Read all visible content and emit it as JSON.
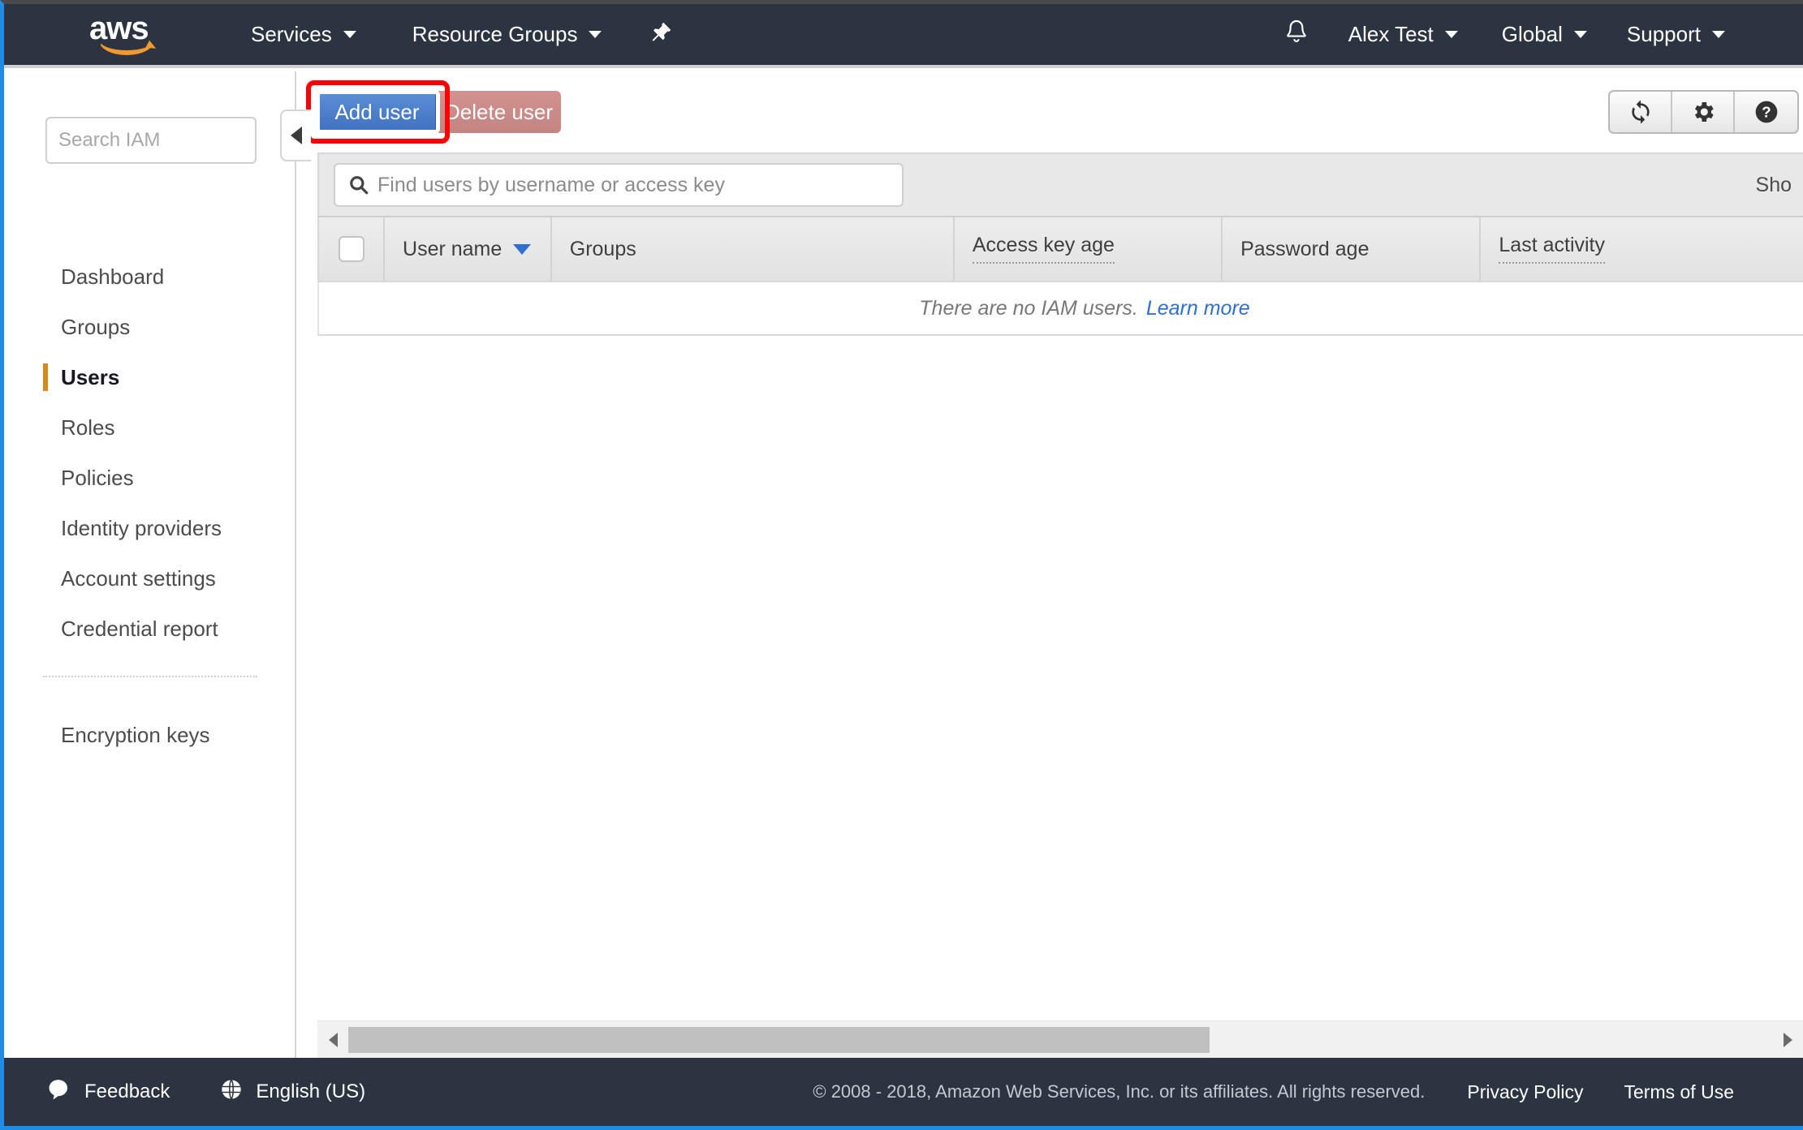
{
  "topnav": {
    "logo_text": "aws",
    "logo_name": "aws-logo",
    "services_label": "Services",
    "resource_groups_label": "Resource Groups",
    "pin_icon": "pin-icon",
    "bell_icon": "bell-notification-icon",
    "account_label": "Alex Test",
    "region_label": "Global",
    "support_label": "Support"
  },
  "sidebar": {
    "search_placeholder": "Search IAM",
    "search_value": "",
    "items": [
      {
        "label": "Dashboard",
        "active": false
      },
      {
        "label": "Groups",
        "active": false
      },
      {
        "label": "Users",
        "active": true
      },
      {
        "label": "Roles",
        "active": false
      },
      {
        "label": "Policies",
        "active": false
      },
      {
        "label": "Identity providers",
        "active": false
      },
      {
        "label": "Account settings",
        "active": false
      },
      {
        "label": "Credential report",
        "active": false
      }
    ],
    "secondary_items": [
      {
        "label": "Encryption keys",
        "active": false
      }
    ],
    "collapse_icon": "chevron-left-icon"
  },
  "actionbar": {
    "add_user_label": "Add user",
    "delete_user_label": "Delete user",
    "highlight_color": "#fb0007",
    "add_user_color": "#3f71c0",
    "delete_user_color": "#c28582",
    "icons": [
      {
        "name": "refresh-icon",
        "label": "Refresh"
      },
      {
        "name": "gear-icon",
        "label": "Settings"
      },
      {
        "name": "help-question-icon",
        "label": "Help"
      }
    ]
  },
  "table": {
    "search_placeholder": "Find users by username or access key",
    "search_value": "",
    "search_icon": "search-icon",
    "showing_text": "Sho",
    "select_all_checkbox": "unchecked",
    "columns": [
      {
        "label": "User name",
        "sorted": true,
        "sort_direction": "desc",
        "tooltip": false
      },
      {
        "label": "Groups",
        "sorted": false,
        "tooltip": false
      },
      {
        "label": "Access key age",
        "sorted": false,
        "tooltip": true
      },
      {
        "label": "Password age",
        "sorted": false,
        "tooltip": false
      },
      {
        "label": "Last activity",
        "sorted": false,
        "tooltip": true
      }
    ],
    "rows": [],
    "empty_message": "There are no IAM users.",
    "empty_link_label": "Learn more",
    "sort_caret_color": "#2f6fd0"
  },
  "scrollbar": {
    "left_arrow": "scroll-left-arrow-icon",
    "right_arrow": "scroll-right-arrow-icon",
    "thumb_position": "0%",
    "thumb_width": "60.5%"
  },
  "footer": {
    "feedback_label": "Feedback",
    "feedback_icon": "speech-bubble-icon",
    "language_label": "English (US)",
    "language_icon": "globe-icon",
    "copyright": "© 2008 - 2018, Amazon Web Services, Inc. or its affiliates. All rights reserved.",
    "privacy_label": "Privacy Policy",
    "terms_label": "Terms of Use"
  }
}
